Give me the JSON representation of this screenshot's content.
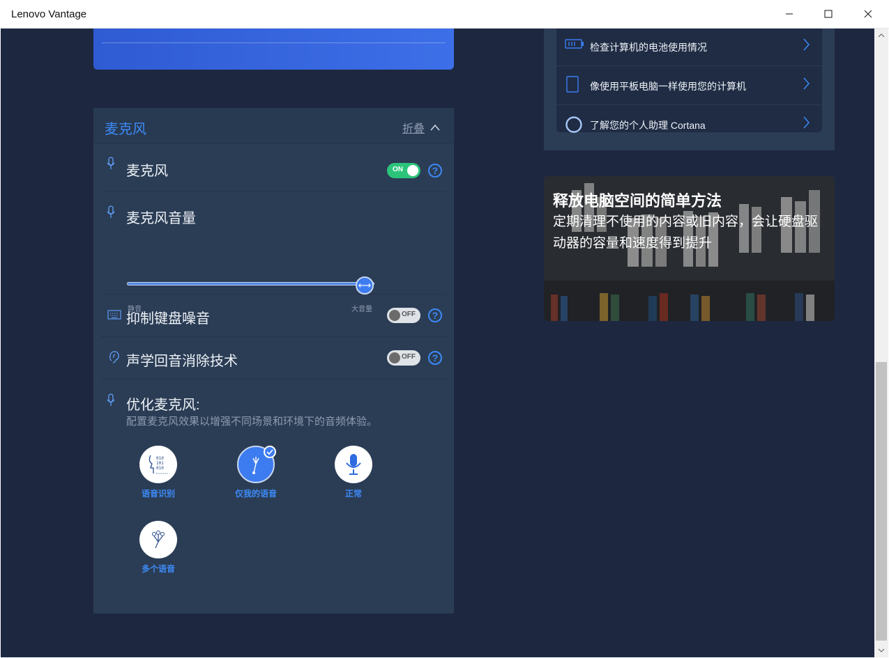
{
  "window": {
    "title": "Lenovo Vantage"
  },
  "microphone": {
    "header": "麦克风",
    "collapse_label": "折叠",
    "rows": {
      "mic": {
        "label": "麦克风",
        "toggle": "ON"
      },
      "volume": {
        "label": "麦克风音量",
        "min_label": "静音",
        "max_label": "大音量",
        "value_fraction": 1.0
      },
      "keyboard_noise": {
        "label": "抑制键盘噪音",
        "toggle": "OFF"
      },
      "echo_cancel": {
        "label": "声学回音消除技术",
        "toggle": "OFF"
      }
    },
    "help_glyph": "?",
    "optimize": {
      "title": "优化麦克风:",
      "desc": "配置麦克风效果以增强不同场景和环境下的音频体验。",
      "options": [
        {
          "label": "语音识别",
          "icon": "speech-recognition-icon",
          "selected": false
        },
        {
          "label": "仅我的语音",
          "icon": "only-my-voice-icon",
          "selected": true
        },
        {
          "label": "正常",
          "icon": "microphone-icon",
          "selected": false
        },
        {
          "label": "多个语音",
          "icon": "multiple-voices-icon",
          "selected": false
        }
      ]
    }
  },
  "quick_links": [
    {
      "label": "检查计算机的电池使用情况",
      "icon": "battery-icon"
    },
    {
      "label": "像使用平板电脑一样使用您的计算机",
      "icon": "tablet-icon"
    },
    {
      "label": "了解您的个人助理 Cortana",
      "icon": "cortana-icon"
    }
  ],
  "promo": {
    "title": "释放电脑空间的简单方法",
    "desc": "定期清理不使用的内容或旧内容，会让硬盘驱动器的容量和速度得到提升"
  },
  "colors": {
    "accent": "#3d8af7",
    "toggle_on": "#2cc47b",
    "background": "#1d2840",
    "panel": "#2b3d55"
  }
}
